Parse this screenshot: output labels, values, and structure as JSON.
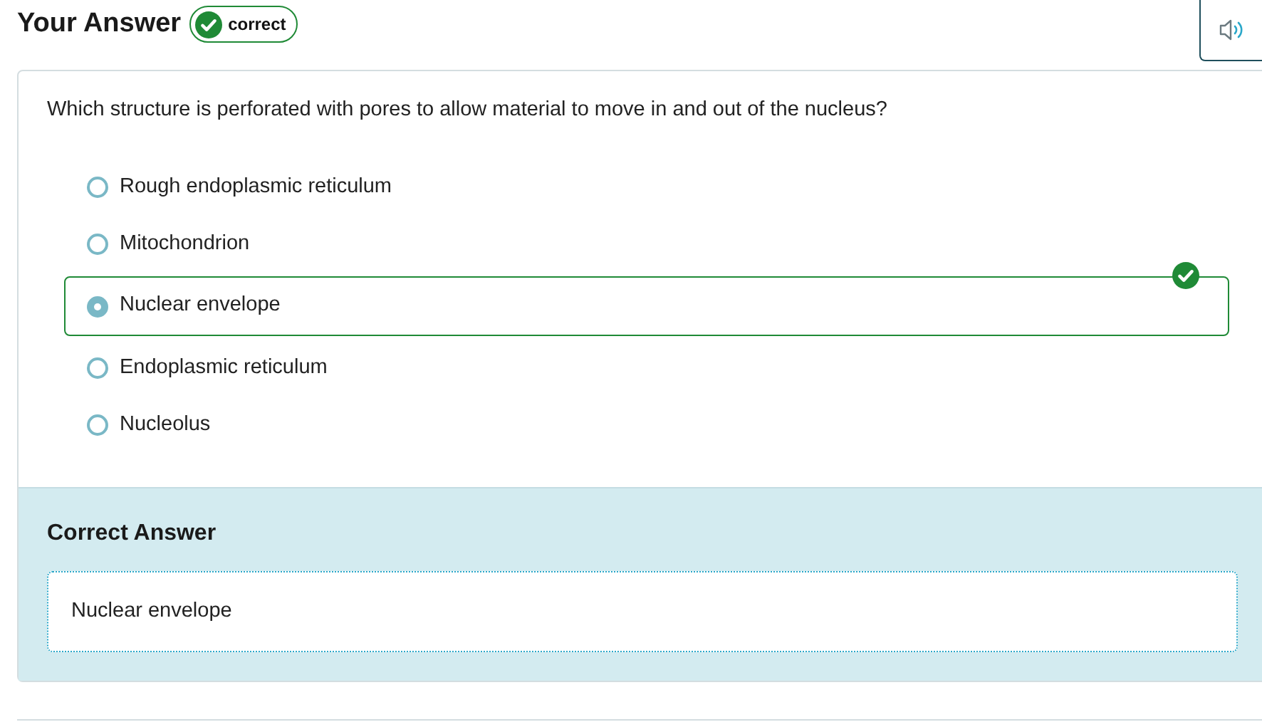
{
  "heading": "Your Answer",
  "status_badge": {
    "label": "correct"
  },
  "question": "Which structure is perforated with pores to allow material to move in and out of the nucleus?",
  "options": [
    {
      "label": "Rough endoplasmic reticulum",
      "selected": false
    },
    {
      "label": "Mitochondrion",
      "selected": false
    },
    {
      "label": "Nuclear envelope",
      "selected": true
    },
    {
      "label": "Endoplasmic reticulum",
      "selected": false
    },
    {
      "label": "Nucleolus",
      "selected": false
    }
  ],
  "correct_answer": {
    "title": "Correct Answer",
    "value": "Nuclear envelope"
  }
}
